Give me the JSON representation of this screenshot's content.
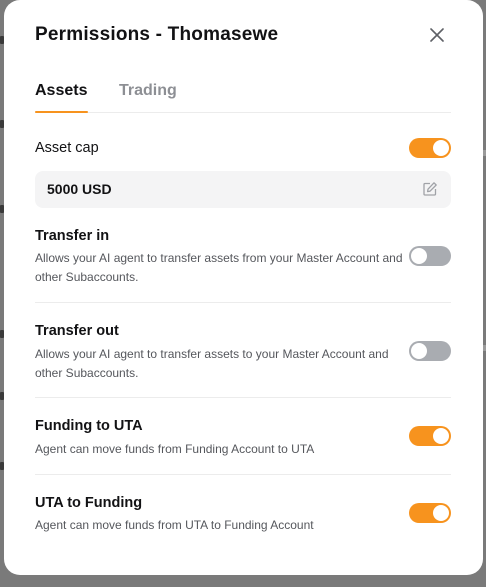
{
  "modal": {
    "title": "Permissions - Thomasewe",
    "close_icon": "close-icon"
  },
  "tabs": [
    {
      "label": "Assets",
      "active": true
    },
    {
      "label": "Trading",
      "active": false
    }
  ],
  "asset_cap": {
    "label": "Asset cap",
    "enabled": true,
    "value": "5000 USD",
    "edit_icon": "edit-icon"
  },
  "permissions": [
    {
      "title": "Transfer in",
      "description": "Allows your AI agent to transfer assets from your Master Account and other Subaccounts.",
      "enabled": false
    },
    {
      "title": "Transfer out",
      "description": "Allows your AI agent to transfer assets to your Master Account and other Subaccounts.",
      "enabled": false
    },
    {
      "title": "Funding to UTA",
      "description": "Agent can move funds from Funding Account to UTA",
      "enabled": true
    },
    {
      "title": "UTA to Funding",
      "description": "Agent can move funds from UTA to Funding Account",
      "enabled": true
    }
  ],
  "colors": {
    "accent": "#f7931e",
    "toggle_off": "#a9acb1",
    "text": "#121214",
    "muted": "#55575c"
  }
}
